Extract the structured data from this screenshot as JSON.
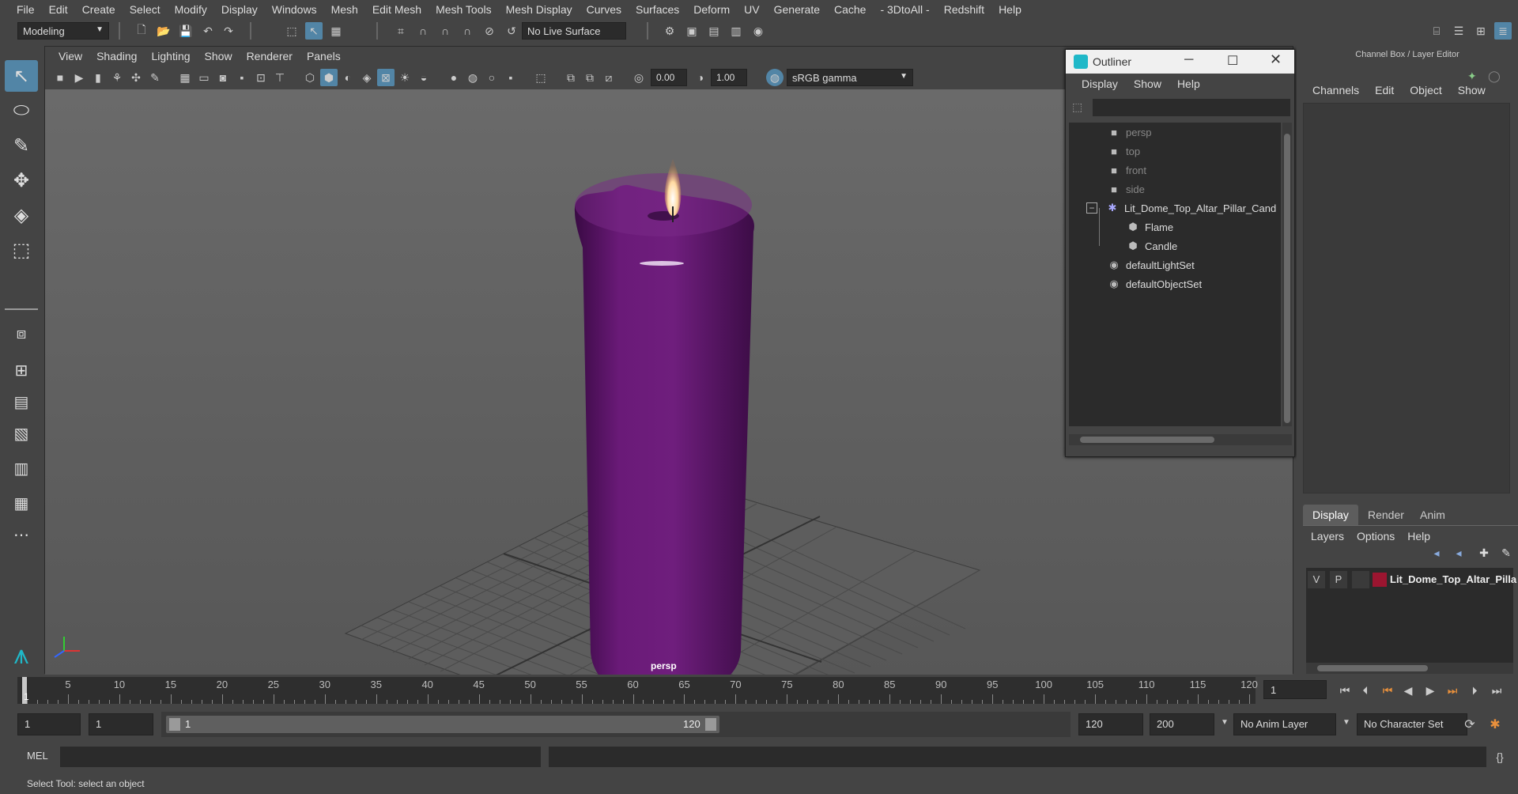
{
  "menubar": {
    "items": [
      "File",
      "Edit",
      "Create",
      "Select",
      "Modify",
      "Display",
      "Windows",
      "Mesh",
      "Edit Mesh",
      "Mesh Tools",
      "Mesh Display",
      "Curves",
      "Surfaces",
      "Deform",
      "UV",
      "Generate",
      "Cache",
      "- 3DtoAll -",
      "Redshift",
      "Help"
    ]
  },
  "toolbar": {
    "mode": "Modeling",
    "live_surface": "No Live Surface"
  },
  "viewport": {
    "menu": [
      "View",
      "Shading",
      "Lighting",
      "Show",
      "Renderer",
      "Panels"
    ],
    "exposure": "0.00",
    "gamma": "1.00",
    "color_space": "sRGB gamma",
    "camera_label": "persp",
    "colors": {
      "candle": "#6a1a78",
      "background": "#5e5e5e"
    }
  },
  "outliner": {
    "title": "Outliner",
    "menu": [
      "Display",
      "Show",
      "Help"
    ],
    "items": [
      {
        "label": "persp",
        "icon": "camera-icon",
        "dim": true
      },
      {
        "label": "top",
        "icon": "camera-icon",
        "dim": true
      },
      {
        "label": "front",
        "icon": "camera-icon",
        "dim": true
      },
      {
        "label": "side",
        "icon": "camera-icon",
        "dim": true
      },
      {
        "label": "Lit_Dome_Top_Altar_Pillar_Cand",
        "icon": "group-icon",
        "dim": false
      },
      {
        "label": "Flame",
        "icon": "mesh-icon",
        "dim": false
      },
      {
        "label": "Candle",
        "icon": "mesh-icon",
        "dim": false
      },
      {
        "label": "defaultLightSet",
        "icon": "set-icon",
        "dim": false
      },
      {
        "label": "defaultObjectSet",
        "icon": "set-icon",
        "dim": false
      }
    ]
  },
  "channelbox": {
    "title": "Channel Box / Layer Editor",
    "menu": [
      "Channels",
      "Edit",
      "Object",
      "Show"
    ]
  },
  "layers": {
    "tabs": [
      "Display",
      "Render",
      "Anim"
    ],
    "menu": [
      "Layers",
      "Options",
      "Help"
    ],
    "layer": {
      "v": "V",
      "p": "P",
      "name": "Lit_Dome_Top_Altar_Pilla",
      "color": "#9b1530"
    }
  },
  "timeline": {
    "ticks": [
      "5",
      "10",
      "15",
      "20",
      "25",
      "30",
      "35",
      "40",
      "45",
      "50",
      "55",
      "60",
      "65",
      "70",
      "75",
      "80",
      "85",
      "90",
      "95",
      "100",
      "105",
      "110",
      "115",
      "120"
    ],
    "current_frame": "1",
    "current_marker": "1"
  },
  "range": {
    "start": "1",
    "playback_start": "1",
    "slider_start": "1",
    "slider_end": "120",
    "playback_end": "120",
    "end": "200",
    "anim_layer": "No Anim Layer",
    "character_set": "No Character Set"
  },
  "cmdline": {
    "label": "MEL"
  },
  "status": {
    "text": "Select Tool: select an object"
  }
}
